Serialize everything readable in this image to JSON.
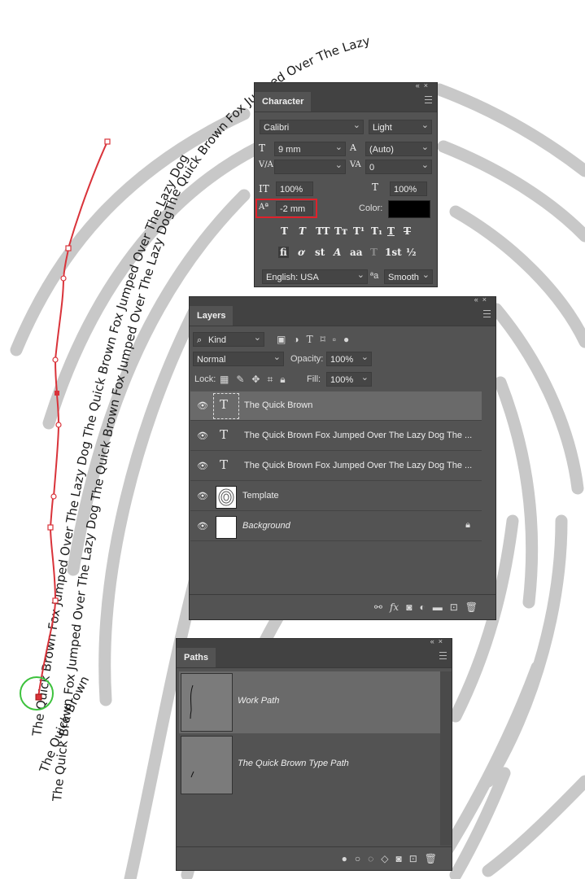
{
  "canvas": {
    "curve_texts": [
      "The Quick Brown Fox Jumped Over The Lazy Dog The Quick Brown Fox Jumped Over The Lazy Dog",
      "The Quick Brown",
      "The Quick Brown Fox Jumped Over The Lazy Dog The Quick Brown Fox Jumped Over The Lazy DogThe Quick Brown Fox Jumped Over The Lazy"
    ]
  },
  "character": {
    "tab": "Character",
    "font_family": "Calibri",
    "font_style": "Light",
    "font_size": "9 mm",
    "leading": "(Auto)",
    "kerning": "",
    "tracking": "0",
    "vertical_scale": "100%",
    "horizontal_scale": "100%",
    "baseline_shift": "-2 mm",
    "color_label": "Color:",
    "color_value": "#000000",
    "language": "English: USA",
    "aa_label": "ªa",
    "antialias": "Smooth"
  },
  "layers": {
    "tab": "Layers",
    "filter": "Kind",
    "blend_mode": "Normal",
    "opacity_label": "Opacity:",
    "opacity": "100%",
    "lock_label": "Lock:",
    "fill_label": "Fill:",
    "fill": "100%",
    "items": [
      {
        "name": "The Quick Brown",
        "type": "text",
        "selected": true
      },
      {
        "name": "The Quick Brown Fox Jumped Over The Lazy Dog The ...",
        "type": "text"
      },
      {
        "name": "The Quick Brown Fox Jumped Over The Lazy Dog The ...",
        "type": "text"
      },
      {
        "name": "Template",
        "type": "image"
      },
      {
        "name": "Background",
        "type": "background",
        "locked": true
      }
    ]
  },
  "paths": {
    "tab": "Paths",
    "items": [
      {
        "name": "Work Path",
        "selected": true
      },
      {
        "name": "The Quick Brown Type Path"
      }
    ]
  }
}
